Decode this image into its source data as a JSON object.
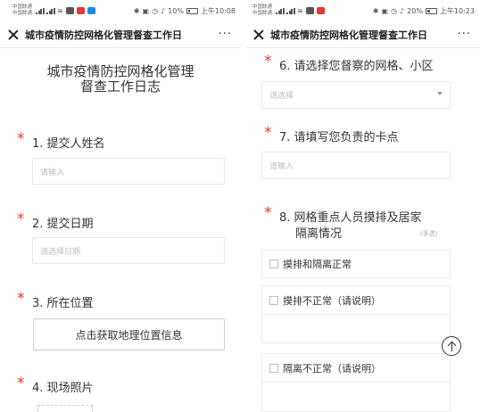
{
  "left": {
    "status": {
      "carrier_top": "中国联通",
      "carrier_bottom": "中国联通",
      "battery": "10%",
      "time": "上午10:08"
    },
    "title": "城市疫情防控网格化管理督查工作日",
    "more": "···",
    "form_title_line1": "城市疫情防控网格化管理",
    "form_title_line2": "督查工作日志",
    "questions": [
      {
        "star": "*",
        "label": "1.  提交人姓名",
        "placeholder": "请输入"
      },
      {
        "star": "*",
        "label": "2.  提交日期",
        "placeholder": "请选择日期"
      },
      {
        "star": "*",
        "label": "3.  所在位置",
        "button": "点击获取地理位置信息"
      },
      {
        "star": "*",
        "label": "4.  现场照片"
      }
    ]
  },
  "right": {
    "status": {
      "carrier_top": "中国联通",
      "carrier_bottom": "中国联通",
      "battery": "20%",
      "time": "上午10:23"
    },
    "title": "城市疫情防控网格化管理督查工作日",
    "more": "···",
    "questions": [
      {
        "star": "*",
        "label": "6.  请选择您督察的网格、小区",
        "placeholder": "请选择"
      },
      {
        "star": "*",
        "label": "7.  请填写您负责的卡点",
        "placeholder": "请输入"
      },
      {
        "star": "*",
        "label_line1": "8.  网格重点人员摸排及居家",
        "label_line2": "隔离情况",
        "hint": "(多选)",
        "options": [
          "摸排和隔离正常",
          "摸排不正常（请说明）",
          "隔离不正常（请说明）"
        ]
      }
    ]
  },
  "colors": {
    "required": "#e53935",
    "border": "#e9e9e9",
    "placeholder": "#bdbdbd"
  }
}
